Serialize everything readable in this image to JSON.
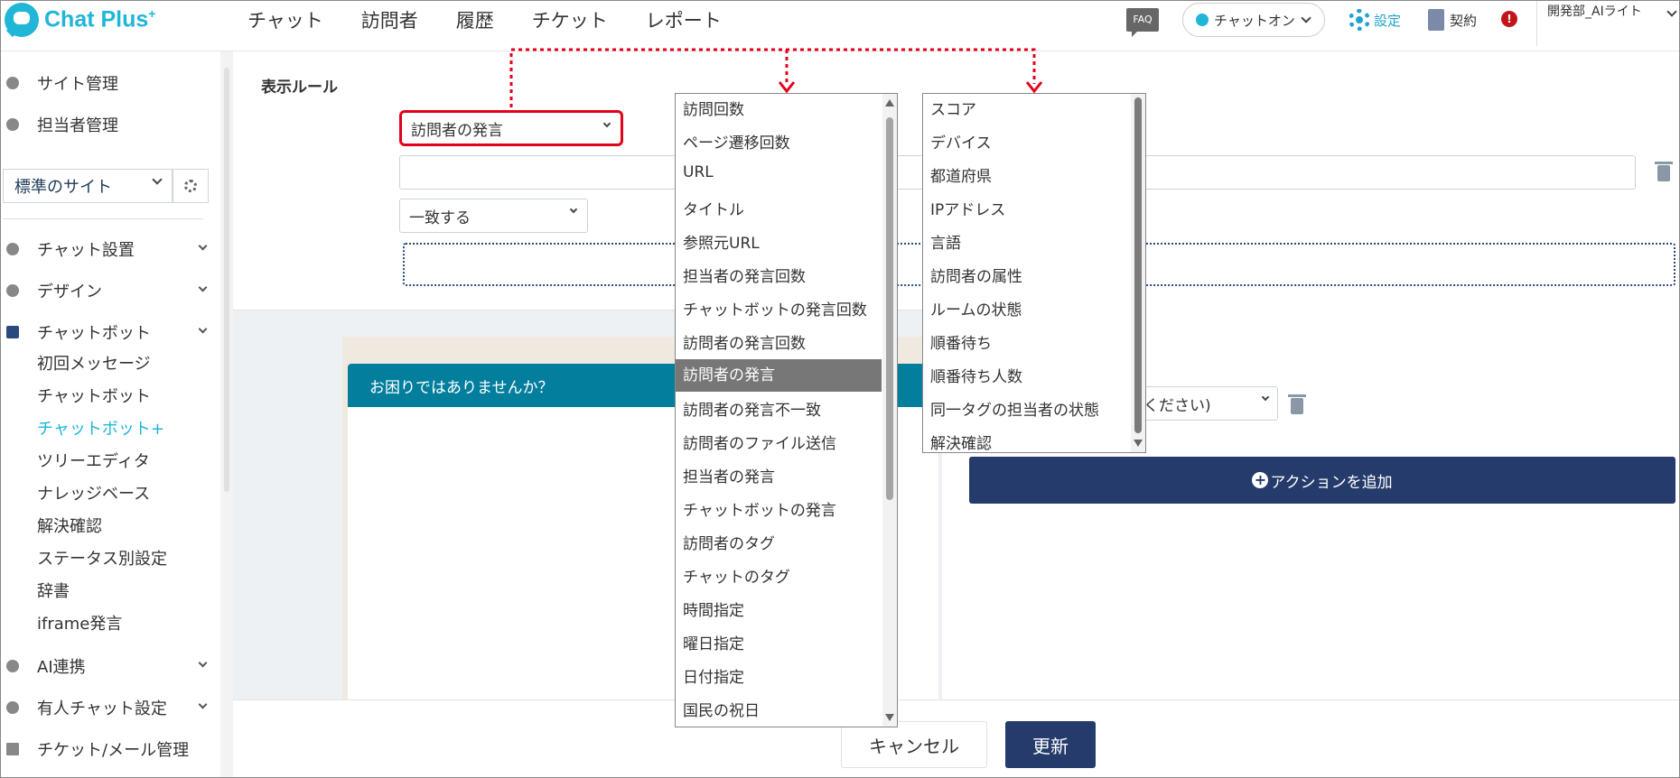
{
  "app": {
    "logo_text": "Chat Plus",
    "logo_sup": "+"
  },
  "nav": [
    "チャット",
    "訪問者",
    "履歴",
    "チケット",
    "レポート"
  ],
  "header": {
    "faq": "FAQ",
    "chat_status": "チャットオン",
    "settings": "設定",
    "contract": "契約",
    "alert": "!",
    "user_name": "開発部_AIライト"
  },
  "sidebar": {
    "site_admin": "サイト管理",
    "staff_admin": "担当者管理",
    "site_select": "標準のサイト",
    "chat_setup": "チャット設置",
    "design": "デザイン",
    "chatbot": "チャットボット",
    "chatbot_sub": [
      "初回メッセージ",
      "チャットボット",
      "チャットボット+",
      "ツリーエディタ",
      "ナレッジベース",
      "解決確認",
      "ステータス別設定",
      "辞書",
      "iframe発言"
    ],
    "ai": "AI連携",
    "manned_chat": "有人チャット設定",
    "ticket_mail": "チケット/メール管理"
  },
  "main": {
    "section_title": "表示ルール",
    "condition_value": "訪問者の発言",
    "match_value": "一致する",
    "preview_header": "お困りではありませんか？",
    "partial_select_text": "ください)",
    "add_action": "アクションを追加",
    "cancel": "キャンセル",
    "update": "更新"
  },
  "dropdown_conditions": {
    "items": [
      "訪問回数",
      "ページ遷移回数",
      "URL",
      "タイトル",
      "参照元URL",
      "担当者の発言回数",
      "チャットボットの発言回数",
      "訪問者の発言回数",
      "訪問者の発言",
      "訪問者の発言不一致",
      "訪問者のファイル送信",
      "担当者の発言",
      "チャットボットの発言",
      "訪問者のタグ",
      "チャットのタグ",
      "時間指定",
      "曜日指定",
      "日付指定",
      "国民の祝日"
    ],
    "selected_index": 8
  },
  "dropdown_conditions_2": {
    "items": [
      "スコア",
      "デバイス",
      "都道府県",
      "IPアドレス",
      "言語",
      "訪問者の属性",
      "ルームの状態",
      "順番待ち",
      "順番待ち人数",
      "同一タグの担当者の状態",
      "解決確認"
    ]
  },
  "colors": {
    "accent": "#1fb6d8",
    "primary": "#243b6b",
    "highlight_red": "#e3001b",
    "preview_header": "#047e9d"
  }
}
